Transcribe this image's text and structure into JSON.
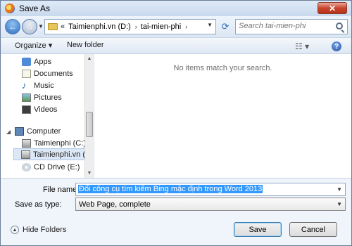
{
  "window": {
    "title": "Save As",
    "close_label": "✕"
  },
  "address": {
    "overflow": "«",
    "crumbs": [
      "Taimienphi.vn (D:)",
      "tai-mien-phi"
    ],
    "separator": "›",
    "search_placeholder": "Search tai-mien-phi"
  },
  "toolbar": {
    "organize_label": "Organize ▾",
    "new_folder_label": "New folder",
    "help_label": "?"
  },
  "nav": {
    "items": [
      {
        "label": "Apps",
        "icon": "apps-icon"
      },
      {
        "label": "Documents",
        "icon": "documents-icon"
      },
      {
        "label": "Music",
        "icon": "music-icon"
      },
      {
        "label": "Pictures",
        "icon": "pictures-icon"
      },
      {
        "label": "Videos",
        "icon": "videos-icon"
      }
    ],
    "computer_label": "Computer",
    "drives": [
      {
        "label": "Taimienphi (C:)",
        "icon": "drive-icon"
      },
      {
        "label": "Taimienphi.vn (D",
        "icon": "drive-icon",
        "selected": true
      },
      {
        "label": "CD Drive (E:)",
        "icon": "cd-icon"
      }
    ]
  },
  "content": {
    "empty_message": "No items match your search."
  },
  "form": {
    "file_name_label": "File name:",
    "file_name_value": "Đổi công cụ tìm kiếm Bing mặc định trong Word 2013",
    "save_type_label": "Save as type:",
    "save_type_value": "Web Page, complete"
  },
  "footer": {
    "hide_folders_label": "Hide Folders",
    "save_label": "Save",
    "cancel_label": "Cancel"
  },
  "colors": {
    "accent": "#3399ff",
    "frame": "#dbe6f3"
  }
}
